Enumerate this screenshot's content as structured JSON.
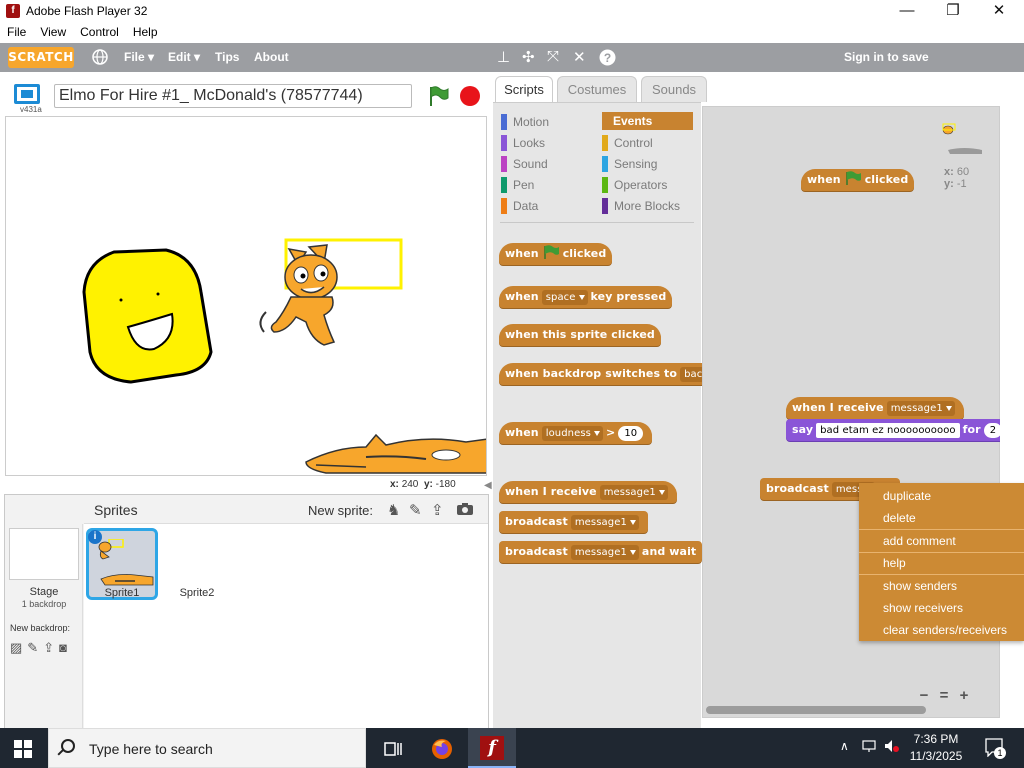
{
  "window": {
    "title": "Adobe Flash Player 32",
    "minimize": "—",
    "maximize": "❐",
    "close": "✕"
  },
  "flash_menu": [
    "File",
    "View",
    "Control",
    "Help"
  ],
  "scratch_bar": {
    "logo": "SCRATCH",
    "menus": {
      "file": "File ▾",
      "edit": "Edit ▾",
      "tips": "Tips",
      "about": "About"
    },
    "sign_in": "Sign in to save"
  },
  "stage": {
    "version": "v431a",
    "project_title": "Elmo For Hire #1_ McDonald's (78577744)",
    "x_label": "x:",
    "x_value": "240",
    "y_label": "y:",
    "y_value": "-180"
  },
  "sprites_pane": {
    "title": "Sprites",
    "new_sprite": "New sprite:",
    "stage_label": "Stage",
    "stage_sub": "1 backdrop",
    "new_backdrop": "New backdrop:",
    "sprite1": "Sprite1",
    "sprite2": "Sprite2"
  },
  "tabs": {
    "scripts": "Scripts",
    "costumes": "Costumes",
    "sounds": "Sounds"
  },
  "categories": {
    "motion": "Motion",
    "looks": "Looks",
    "sound": "Sound",
    "pen": "Pen",
    "data": "Data",
    "events": "Events",
    "control": "Control",
    "sensing": "Sensing",
    "operators": "Operators",
    "more": "More Blocks"
  },
  "palette_blocks": {
    "when": "when",
    "clicked": "clicked",
    "key_pressed_when": "when",
    "space": "space",
    "key_pressed": "key pressed",
    "sprite_clicked": "when this sprite clicked",
    "backdrop_switches": "when backdrop switches to",
    "backdrop_val": "backd",
    "loudness_when": "when",
    "loudness": "loudness",
    "gt": ">",
    "loud_val": "10",
    "receive": "when I receive",
    "message1": "message1",
    "broadcast": "broadcast",
    "and_wait": "and wait"
  },
  "scripts_area": {
    "sprite_x_label": "x:",
    "sprite_x": "60",
    "sprite_y_label": "y:",
    "sprite_y": "-1",
    "when": "when",
    "clicked": "clicked",
    "receive": "when I receive",
    "message1": "message1",
    "say": "say",
    "say_text": "bad etam ez noooooooooo",
    "for": "for",
    "secs": "2",
    "broadcast": "broadcast",
    "broadcast_val": "mess",
    "zoom_out": "−",
    "zoom_reset": "=",
    "zoom_in": "+"
  },
  "context_menu": [
    "duplicate",
    "delete",
    "add comment",
    "help",
    "show senders",
    "show receivers",
    "clear senders/receivers"
  ],
  "taskbar": {
    "search_placeholder": "Type here to search",
    "time": "7:36 PM",
    "date": "11/3/2025",
    "notif_count": "1"
  },
  "colors": {
    "events": "#c88330",
    "looks": "#8a55d7",
    "accent": "#2ea6e6",
    "topbar": "#9c9ea2"
  }
}
